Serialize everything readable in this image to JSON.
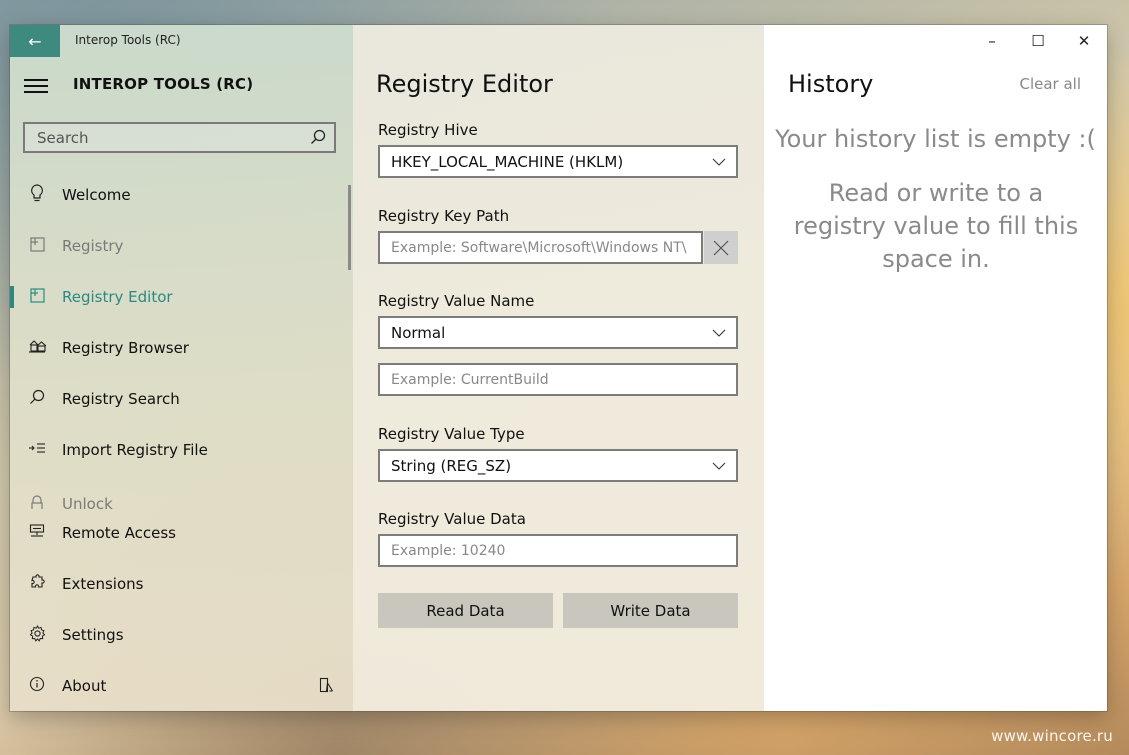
{
  "window": {
    "titlebar_title": "Interop Tools (RC)",
    "app_title": "INTEROP TOOLS (RC)",
    "controls": {
      "minimize": "–",
      "maximize": "☐",
      "close": "✕"
    }
  },
  "search": {
    "placeholder": "Search"
  },
  "nav": {
    "items": [
      {
        "label": "Welcome",
        "icon": "lightbulb-icon"
      },
      {
        "label": "Registry",
        "icon": "registry-icon"
      },
      {
        "label": "Registry Editor",
        "icon": "registry-editor-icon"
      },
      {
        "label": "Registry Browser",
        "icon": "registry-browser-icon"
      },
      {
        "label": "Registry Search",
        "icon": "search-icon"
      },
      {
        "label": "Import Registry File",
        "icon": "import-icon"
      },
      {
        "label": "Unlock",
        "icon": "lock-icon"
      },
      {
        "label": "Remote Access",
        "icon": "remote-icon"
      },
      {
        "label": "Extensions",
        "icon": "puzzle-icon"
      },
      {
        "label": "Settings",
        "icon": "gear-icon"
      },
      {
        "label": "About",
        "icon": "info-icon"
      }
    ]
  },
  "editor": {
    "title": "Registry Editor",
    "hive_label": "Registry Hive",
    "hive_value": "HKEY_LOCAL_MACHINE (HKLM)",
    "key_path_label": "Registry Key Path",
    "key_path_placeholder": "Example: Software\\Microsoft\\Windows NT\\",
    "value_name_label": "Registry Value Name",
    "value_name_mode": "Normal",
    "value_name_placeholder": "Example: CurrentBuild",
    "value_type_label": "Registry Value Type",
    "value_type_value": "String (REG_SZ)",
    "value_data_label": "Registry Value Data",
    "value_data_placeholder": "Example: 10240",
    "read_button": "Read Data",
    "write_button": "Write Data"
  },
  "history": {
    "title": "History",
    "clear_all": "Clear all",
    "empty_title": "Your history list is empty :(",
    "empty_hint": "Read or write to a registry value to fill this space in."
  },
  "watermark": "www.wincore.ru",
  "colors": {
    "accent": "#2a8a82",
    "back_button": "#3f8a7e"
  }
}
